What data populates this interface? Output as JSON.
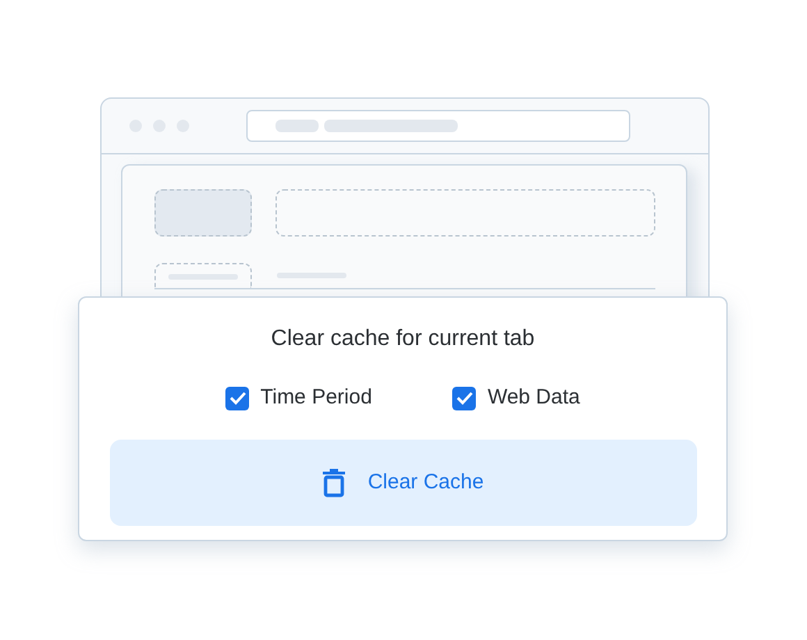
{
  "dialog": {
    "title": "Clear cache for current tab",
    "options": [
      {
        "label": "Time Period",
        "checked": true
      },
      {
        "label": "Web Data",
        "checked": true
      }
    ],
    "button": {
      "label": "Clear Cache"
    }
  }
}
